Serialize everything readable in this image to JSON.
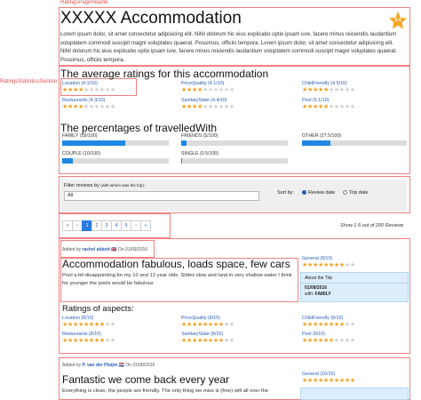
{
  "annotations": {
    "header_tag": "RatingsPageHeader",
    "stats_tag": "RatingsStatisticsSection"
  },
  "header": {
    "title": "XXXXX Accommodation",
    "description": "Lorem ipsum dolor, sit amet consectetur adipisicing elit. Nihil dolorum hic eius explicabo optio ipsam iure, facere minus reiciendis laudantium voluptatem commodi suscipit magni voluptates quaerat. Possimus, officiis tempora. Lorem ipsum dolor, sit amet consectetur adipisicing elit. Nihil dolorum hic eius explicabo optio ipsam iure, facere minus reiciendis laudantium voluptatem commodi suscipit magni voluptates quaerat. Possimus, officiis tempora.",
    "overall_rating": "4.4",
    "badge_color": "#f5a623"
  },
  "averages": {
    "title": "The average ratings for this accommodation",
    "items": [
      {
        "label": "Location (4.1/10)",
        "value": 4.1
      },
      {
        "label": "PriceQuality (4.1/10)",
        "value": 4.1
      },
      {
        "label": "ChildFriendly (4.5/10)",
        "value": 4.5
      },
      {
        "label": "Restaurants (4.3/10)",
        "value": 4.3
      },
      {
        "label": "SanitaryState (4.4/10)",
        "value": 4.4
      },
      {
        "label": "Pool (5.1/10)",
        "value": 5.1
      }
    ]
  },
  "travelled": {
    "title": "The percentages of travelledWith",
    "items": [
      {
        "label": "FAMILY (59/100)",
        "value": 59
      },
      {
        "label": "FRIENDS (5/100)",
        "value": 5
      },
      {
        "label": "OTHER (27.5/100)",
        "value": 27.5
      },
      {
        "label": "COUPLE (10/100)",
        "value": 10
      },
      {
        "label": "SINGLE (0.5/100)",
        "value": 0.5
      }
    ],
    "bar_color": "#1e88e5"
  },
  "filter": {
    "label_prefix": "Filter reviews by",
    "label_suffix": "(with whom was the trip):",
    "selected": "All",
    "sort_label": "Sort by:",
    "sort_options": [
      "Review date",
      "Trip date"
    ],
    "sort_selected": "Review date"
  },
  "pagination": {
    "first": "«",
    "prev": "‹",
    "pages": [
      "1",
      "2",
      "3",
      "4",
      "5"
    ],
    "active_page": "1",
    "next": "›",
    "last": "»",
    "showing": "Show 1-5 out of 200 Reviews"
  },
  "reviews": [
    {
      "added_prefix": "Added by",
      "author": "rachel abbott",
      "flag": "🇬🇧",
      "date_prefix": "On",
      "date": "01/09/2016",
      "title": "Accommodation fabulous, loads space, few cars",
      "text": "Pool a bit disappointing for my 10 and 12 year olds. Slides slow and land in very shallow water I think for younger the pools would be fabulous",
      "general": "General (8/10)",
      "general_value": 8,
      "trip_title": "About the Trip",
      "trip_date": "01/08/2016",
      "trip_with_prefix": "with:",
      "trip_with": "FAMILY",
      "aspects_title": "Ratings of aspects:",
      "aspects": [
        {
          "label": "Location (8/10)",
          "value": 8
        },
        {
          "label": "PriceQuality (8/10)",
          "value": 8
        },
        {
          "label": "ChildFriendly (8/10)",
          "value": 8
        },
        {
          "label": "Restaurants (8/10)",
          "value": 8
        },
        {
          "label": "SanitaryState (8/10)",
          "value": 8
        },
        {
          "label": "Pool (6/10)",
          "value": 6
        }
      ]
    },
    {
      "added_prefix": "Added by",
      "author": "P. van der Pluijm",
      "flag": "🇳🇱",
      "date_prefix": "On",
      "date": "31/08/2016",
      "title": "Fantastic we come back every year",
      "text": "Everything is clean, the people are friendly. The only thing we miss is (free) wifi all over the",
      "general": "General (10/10)",
      "general_value": 10
    }
  ]
}
